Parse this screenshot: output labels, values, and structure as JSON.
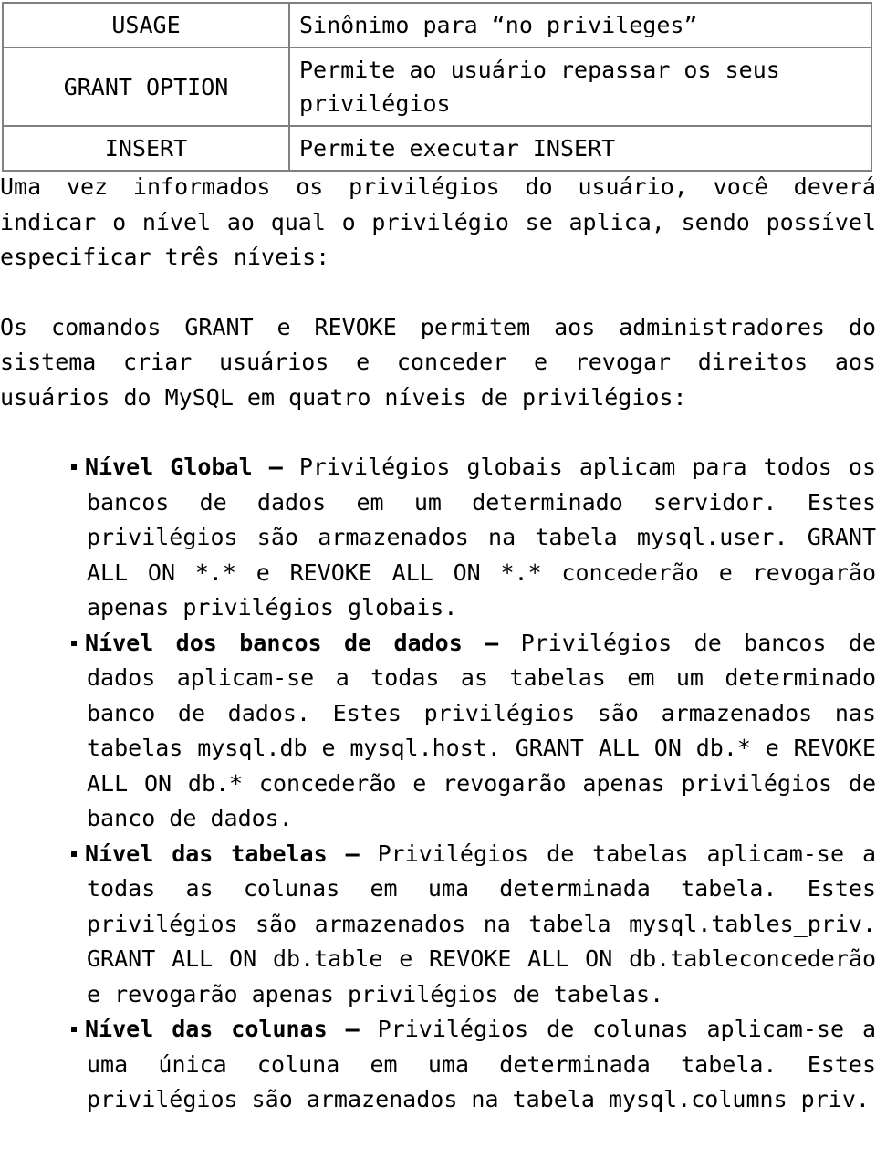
{
  "document": {
    "language": "pt-BR",
    "topic": "MySQL GRANT e REVOKE — níveis de privilégios"
  },
  "table": {
    "rows": [
      {
        "privilege": "USAGE",
        "description": "Sinônimo para “no privileges”"
      },
      {
        "privilege": "GRANT OPTION",
        "description": "Permite ao usuário repassar os seus privilégios"
      },
      {
        "privilege": "INSERT",
        "description": "Permite executar INSERT"
      }
    ]
  },
  "paragraphs": [
    "Uma vez informados os privilégios do usuário, você deverá indicar o nível ao qual o privilégio se aplica, sendo possível especificar três níveis:",
    "Os comandos GRANT e REVOKE permitem aos administradores do sistema criar usuários e conceder e revogar direitos aos usuários do MySQL em quatro níveis de privilégios:"
  ],
  "bullets": [
    {
      "label": "Nível Global",
      "dash": " – ",
      "text": "Privilégios globais aplicam para todos os bancos de dados em um determinado servidor. Estes privilégios são armazenados na tabela mysql.user. GRANT ALL ON *.* e REVOKE ALL ON *.* concederão e revogarão apenas privilégios globais."
    },
    {
      "label": "Nível dos bancos de dados",
      "dash": " – ",
      "text": "Privilégios de bancos de dados aplicam-se a todas as tabelas em um determinado banco de dados. Estes privilégios são armazenados nas tabelas mysql.db e mysql.host. GRANT ALL ON db.* e REVOKE ALL ON db.* concederão e revogarão apenas privilégios de banco de dados."
    },
    {
      "label": "Nível das tabelas",
      "dash": " – ",
      "text": "Privilégios de tabelas aplicam-se a todas as colunas em uma determinada tabela. Estes privilégios são armazenados na tabela mysql.tables_priv. GRANT ALL ON db.table e REVOKE ALL ON db.tableconcederão e revogarão apenas privilégios de tabelas."
    },
    {
      "label": "Nível das colunas",
      "dash": " – ",
      "text": "Privilégios de colunas aplicam-se a uma única coluna em uma determinada tabela. Estes privilégios são armazenados na tabela mysql.columns_priv."
    }
  ],
  "colors": {
    "text": "#000000",
    "background": "#ffffff",
    "table_border": "#808080"
  }
}
